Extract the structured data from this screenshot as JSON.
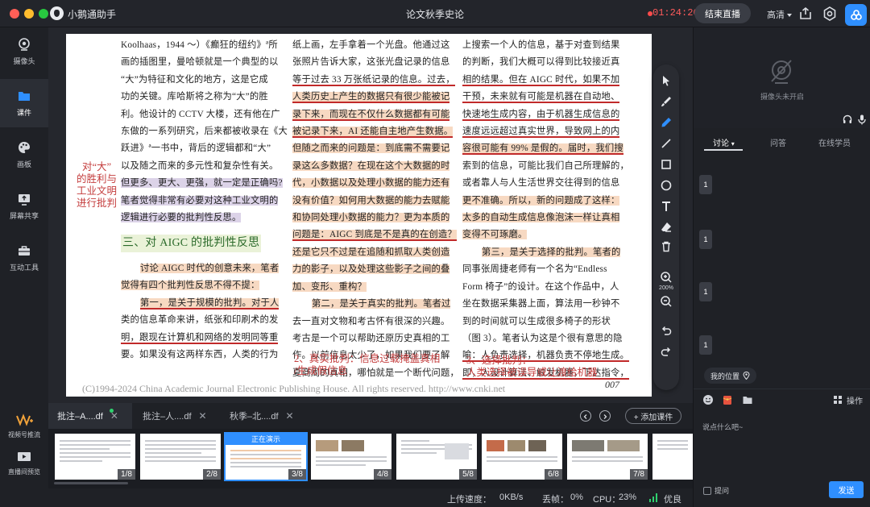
{
  "app": {
    "name": "小鹅通助手",
    "window_title": "论文秋季史论",
    "timer": "01:24:26"
  },
  "header": {
    "end_live_label": "结束直播",
    "quality_label": "高清"
  },
  "colors": {
    "accent": "#2f8fff",
    "rec": "#ff4b4b",
    "good": "#2fd16f"
  },
  "sidebar": {
    "items": [
      {
        "label": "摄像头",
        "icon": "camera-icon"
      },
      {
        "label": "课件",
        "icon": "folder-icon"
      },
      {
        "label": "画板",
        "icon": "palette-icon"
      },
      {
        "label": "屏幕共享",
        "icon": "screen-share-icon"
      },
      {
        "label": "互动工具",
        "icon": "toolbox-icon"
      }
    ],
    "bottom": [
      {
        "label": "视频号推流",
        "icon": "video-channel-icon"
      },
      {
        "label": "直播间预览",
        "icon": "preview-icon"
      }
    ]
  },
  "document": {
    "col1": [
      "Koolhaas，1944 ～）《癫狂的纽约》ª所",
      "画的插图里，曼哈顿就是一个典型的以",
      "“大”为特征和文化的地方，这是它成",
      "功的关键。库哈斯将之称为“大”的胜",
      "利。他设计的 CCTV 大楼，还有他在广",
      "东做的一系列研究，后来都被收录在《大",
      "跃进》ª一书中，背后的逻辑都和“大”",
      "以及随之而来的多元性和复杂性有关。",
      "但更多、更大、更强，就一定是正确吗?",
      "笔者觉得非常有必要对这种工业文明的",
      "逻辑进行必要的批判性反思。"
    ],
    "heading": "三、对 AIGC 的批判性反思",
    "col1b": [
      "讨论 AIGC 时代的创意未来，笔者",
      "觉得有四个批判性反思不得不提：",
      "第一，是关于规模的批判。对于人",
      "类的信息革命来讲，纸张和印刷术的发",
      "明，跟现在计算机和网络的发明同等重",
      "要。如果没有这两样东西，人类的行为"
    ],
    "col2": [
      "纸上画，左手拿着一个光盘。他通过这",
      "张照片告诉大家，这张光盘记录的信息",
      "等于过去 33 万张纸记录的信息。过去，",
      "人类历史上产生的数据只有很少能被记",
      "录下来，而现在不仅什么数据都有可能",
      "被记录下来，AI 还能自主地产生数据。",
      "但随之而来的问题是：到底需不需要记",
      "录这么多数据？在现在这个大数据的时",
      "代，小数据以及处理小数据的能力还有",
      "没有价值？如何用大数据的能力去赋能",
      "和协同处理小数据的能力？更为本质的",
      "问题是：AIGC 到底是不是真的在创造？",
      "还是它只不过是在追随和抓取人类创造",
      "力的影子，以及处理这些影子之间的叠",
      "加、变形、重构？",
      "第二，是关于真实的批判。笔者过",
      "去一直对文物和考古怀有很深的兴趣。",
      "考古是一个可以帮助还原历史真相的工",
      "作。以前信息太少了，如果我们要了解",
      "夏商周的真相，哪怕就是一个断代问题，"
    ],
    "col3": [
      "上搜索一个人的信息，基于对查到结果",
      "的判断，我们大概可以得到比较接近真",
      "相的结果。但在 AIGC 时代，如果不加",
      "干预，未来就有可能是机器在自动地、",
      "快速地生成内容，由于机器生成信息的",
      "速度远远超过真实世界，导致网上的内",
      "容很可能有 99% 是假的。届时，我们搜",
      "索到的信息，可能比我们自己所理解的，",
      "或者靠人与人生活世界交往得到的信息",
      "更不准确。所以，新的问题成了这样：",
      "太多的自动生成信息像泡沫一样让真相",
      "变得不可琢磨。",
      "第三，是关于选择的批判。笔者的",
      "同事张周捷老师有一个名为“Endless",
      "Form 椅子”的设计。在这个作品中，人",
      "坐在数据采集器上面，算法用一秒钟不",
      "到的时间就可以生成很多椅子的形状",
      "（图 3）。笔者认为这是个很有意思的隐",
      "喻：人负责选择，机器负责不停地生成。",
      "即，人设计算法、触发机器，下达指令，"
    ],
    "annotation_left": [
      "对“大”",
      "的胜利与",
      "工业文明",
      "进行批判"
    ],
    "annotation_2": [
      "2、真实批判：信息过载掩盖真相",
      "/生成假信息"
    ],
    "annotation_3": [
      "3、选择批判：",
      "人类选择被误导或让渡给机器"
    ],
    "page_number": "007",
    "watermark": "(C)1994-2024 China Academic Journal Electronic Publishing House. All rights reserved.     http://www.cnki.net"
  },
  "toolbar": {
    "zoom": "200%"
  },
  "files": {
    "tabs": [
      "批注–A....df",
      "批注–人....df",
      "秋季–北....df"
    ],
    "add_label": "+ 添加课件"
  },
  "thumbnails": {
    "items": [
      "1/8",
      "2/8",
      "3/8",
      "4/8",
      "5/8",
      "6/8",
      "7/8"
    ],
    "current_label": "正在演示"
  },
  "status": {
    "upload_label": "上传速度：",
    "upload_value": "0KB/s",
    "drop_label": "丢帧：",
    "drop_value": "0%",
    "cpu_label": "CPU：",
    "cpu_value": "23%",
    "quality_label": "优良"
  },
  "right_panel": {
    "camera_off": "摄像头未开启",
    "tabs": [
      "讨论",
      "问答",
      "在线学员"
    ],
    "messages": [
      "1",
      "1",
      "1",
      "1"
    ],
    "my_position": "我的位置",
    "ops_label": "操作",
    "input_placeholder": "说点什么吧~",
    "ask_label": "提问",
    "send_label": "发送"
  }
}
